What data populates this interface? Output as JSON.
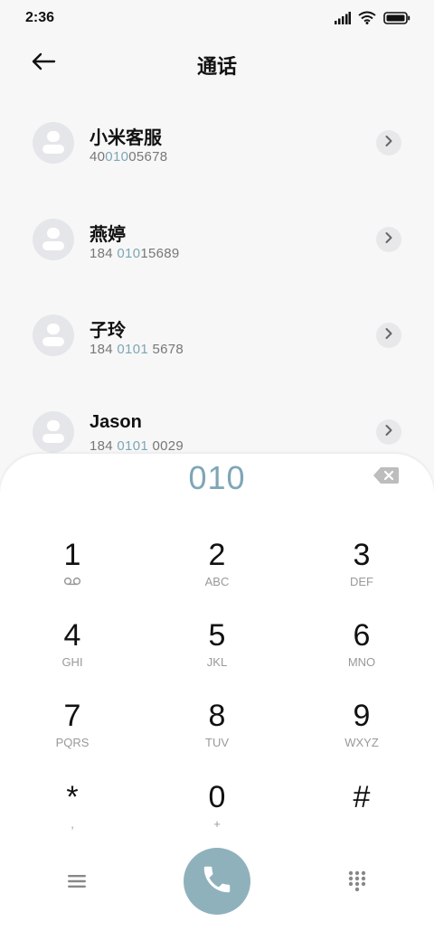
{
  "status": {
    "time": "2:36"
  },
  "header": {
    "title": "通话"
  },
  "results": [
    {
      "name": "小米客服",
      "number_parts": [
        "40",
        "010",
        "05678"
      ]
    },
    {
      "name": "燕婷",
      "number_parts": [
        "184 ",
        "010",
        "15689"
      ]
    },
    {
      "name": "子玲",
      "number_parts": [
        "184 ",
        "0101",
        " 5678"
      ]
    },
    {
      "name": "Jason",
      "number_parts": [
        "184 ",
        "0101",
        " 0029"
      ]
    }
  ],
  "dialpad": {
    "input": "010",
    "keys": [
      {
        "digit": "1",
        "letters": ""
      },
      {
        "digit": "2",
        "letters": "ABC"
      },
      {
        "digit": "3",
        "letters": "DEF"
      },
      {
        "digit": "4",
        "letters": "GHI"
      },
      {
        "digit": "5",
        "letters": "JKL"
      },
      {
        "digit": "6",
        "letters": "MNO"
      },
      {
        "digit": "7",
        "letters": "PQRS"
      },
      {
        "digit": "8",
        "letters": "TUV"
      },
      {
        "digit": "9",
        "letters": "WXYZ"
      },
      {
        "digit": "*",
        "letters": ","
      },
      {
        "digit": "0",
        "letters": "+"
      },
      {
        "digit": "#",
        "letters": ""
      }
    ]
  },
  "icons": {
    "back": "arrow-left-icon",
    "backspace": "backspace-icon",
    "voicemail": "voicemail-icon",
    "menu": "menu-icon",
    "call": "phone-icon",
    "keypad": "keypad-icon"
  },
  "colors": {
    "accent": "#7ea6b6",
    "call_button": "#8fb1bc"
  }
}
